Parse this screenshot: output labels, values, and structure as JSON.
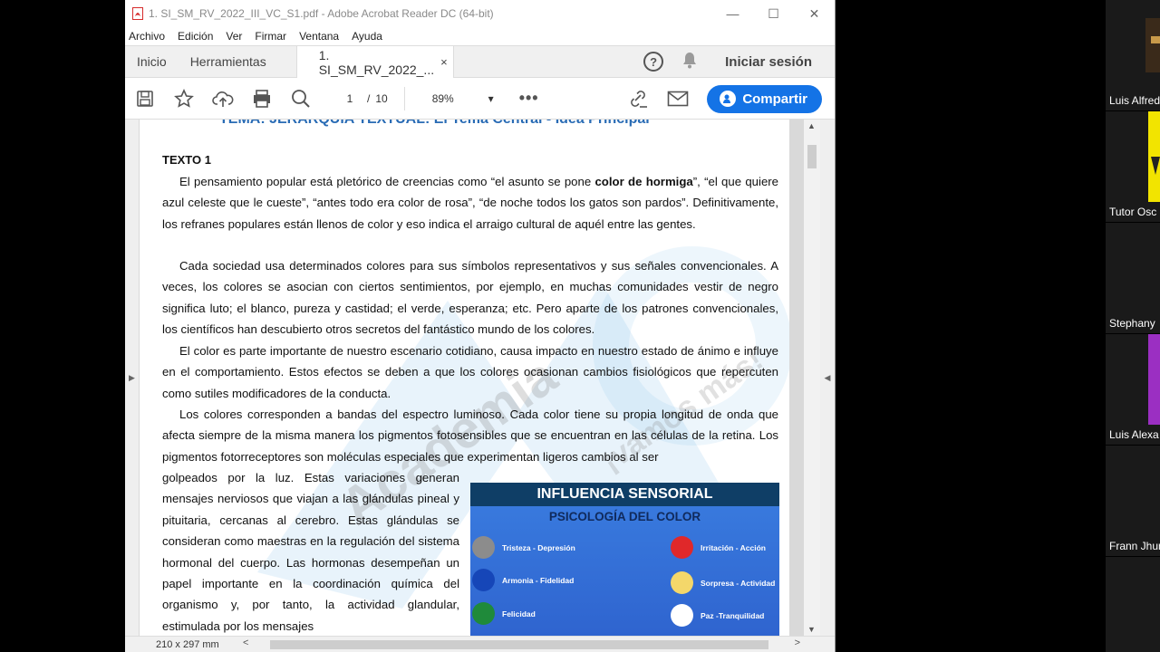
{
  "window": {
    "title": "1. SI_SM_RV_2022_III_VC_S1.pdf - Adobe Acrobat Reader DC (64-bit)",
    "controls": {
      "minimize": "—",
      "maximize": "☐",
      "close": "✕"
    }
  },
  "menu": [
    "Archivo",
    "Edición",
    "Ver",
    "Firmar",
    "Ventana",
    "Ayuda"
  ],
  "tabs": {
    "home": "Inicio",
    "tools": "Herramientas",
    "document": "1. SI_SM_RV_2022_...",
    "close": "×",
    "signin": "Iniciar sesión",
    "help": "?"
  },
  "toolbar": {
    "page_current": "1",
    "page_sep": "/",
    "page_total": "10",
    "zoom": "89%",
    "zoom_caret": "▾",
    "more": "•••",
    "share": "Compartir"
  },
  "document": {
    "heading": "TEMA: JERARQUÍA TEXTUAL: El Tema Central - Idea Principal",
    "texto_label": "TEXTO 1",
    "p1_before": "El pensamiento popular está pletórico de creencias como “el asunto se pone ",
    "p1_bold": "color de hormiga",
    "p1_after": "”, “el que quiere azul celeste que le cueste”, “antes todo era color de rosa”, “de noche todos los gatos son pardos”. Definitivamente, los refranes populares están llenos de color y eso indica el arraigo cultural de aquél entre las gentes.",
    "p2": "Cada sociedad usa determinados colores para sus símbolos representativos y sus señales convencionales. A veces, los colores se asocian con ciertos sentimientos, por ejemplo, en muchas comunidades vestir de negro significa luto; el blanco, pureza y castidad; el verde, esperanza; etc. Pero aparte de los patrones convencionales, los científicos han descubierto otros secretos del fantástico mundo de los colores.",
    "p3": "El color es parte importante de nuestro escenario cotidiano, causa impacto en nuestro estado de ánimo e influye en el comportamiento. Estos efectos se deben a que los colores ocasionan cambios fisiológicos que repercuten como sutiles modificadores de la conducta.",
    "p4": "Los colores corresponden a bandas del espectro luminoso. Cada color tiene su propia longitud de onda que afecta siempre de la misma manera los pigmentos fotosensibles que se encuentran en las células de la retina. Los pigmentos fotorreceptores son moléculas especiales que experimentan ligeros cambios al ser",
    "p5": "golpeados por la luz. Estas variaciones generan mensajes nerviosos que viajan a las glándulas pineal y pituitaria, cercanas al cerebro. Estas glándulas se consideran como maestras en la regulación del sistema hormonal del cuerpo. Las hormonas desempeñan un papel importante en la coordinación química del organismo y, por tanto, la actividad glandular, estimulada por los mensajes",
    "watermark_1": "Academia",
    "watermark_2": "¡vamos más!"
  },
  "infographic": {
    "title": "INFLUENCIA SENSORIAL",
    "subtitle": "PSICOLOGÍA DEL COLOR",
    "items": [
      {
        "label": "Tristeza - Depresión",
        "color": "#8c8c8c"
      },
      {
        "label": "Irritación - Acción",
        "color": "#e0282a"
      },
      {
        "label": "Armonia - Fidelidad",
        "color": "#1646b8"
      },
      {
        "label": "Sorpresa - Actividad",
        "color": "#f4d76a"
      },
      {
        "label": "Felicidad",
        "color": "#1f8a3a"
      },
      {
        "label": "Paz -Tranquilidad",
        "color": "#ffffff"
      }
    ]
  },
  "status": {
    "page_size": "210 x 297 mm"
  },
  "participants": [
    {
      "name": "Luis Alfred"
    },
    {
      "name": "Tutor Osc"
    },
    {
      "name": "Stephany"
    },
    {
      "name": "Luis Alexa"
    },
    {
      "name": "Frann Jhur"
    }
  ],
  "colors": {
    "accent": "#1473e6",
    "heading_blue": "#2a6cb5",
    "infographic_header": "#0f3e66"
  }
}
